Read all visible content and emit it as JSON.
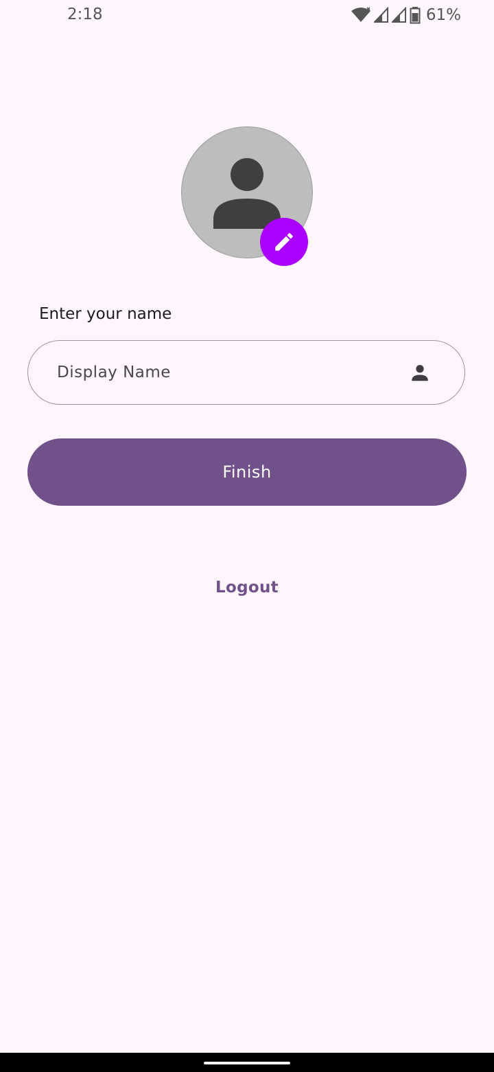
{
  "status_bar": {
    "time": "2:18",
    "battery_percent": "61%",
    "icons": [
      "wifi-icon",
      "signal-icon",
      "signal-icon",
      "battery-icon"
    ]
  },
  "profile": {
    "avatar_icon": "person-icon",
    "edit_icon": "pencil-icon",
    "accent_color": "#AA00FF"
  },
  "form": {
    "name_label": "Enter your name",
    "name_value": "",
    "name_placeholder": "Display Name",
    "name_field_icon": "person-icon"
  },
  "actions": {
    "finish_label": "Finish",
    "logout_label": "Logout",
    "primary_color": "#71518A"
  }
}
